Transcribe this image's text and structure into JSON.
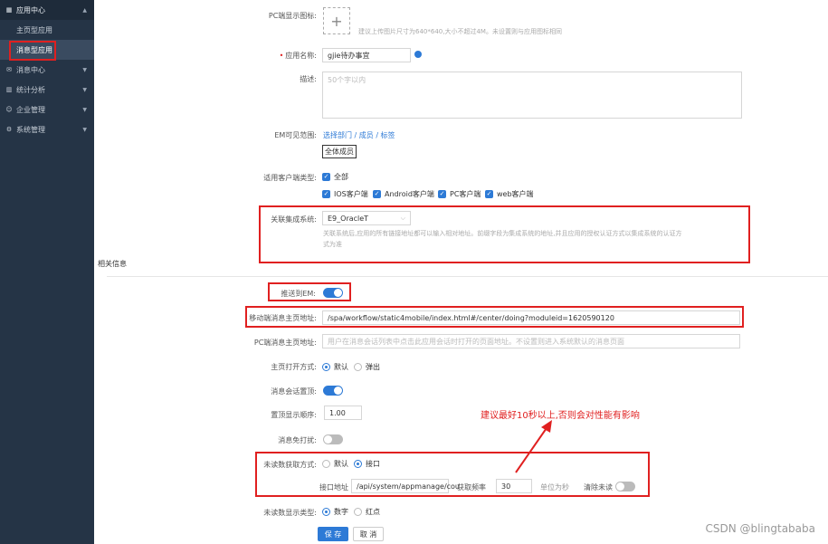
{
  "sidebar": {
    "groups": [
      {
        "label": "应用中心",
        "icon": "grid-icon"
      },
      {
        "label": "消息中心",
        "icon": "mail-icon"
      },
      {
        "label": "统计分析",
        "icon": "chart-icon"
      },
      {
        "label": "企业管理",
        "icon": "user-icon"
      },
      {
        "label": "系统管理",
        "icon": "gear-icon"
      }
    ],
    "sub_items": [
      {
        "label": "主页型应用"
      },
      {
        "label": "消息型应用"
      }
    ]
  },
  "form": {
    "pc_icon": {
      "label": "PC端显示图标:",
      "hint": "建议上传图片尺寸为640*640,大小不超过4M。未设置则与应用图标相同"
    },
    "app_name": {
      "label": "应用名称:",
      "value": "gjie待办事宜"
    },
    "desc": {
      "label": "描述:",
      "placeholder": "50个字以内"
    },
    "em_scope": {
      "label": "EM可见范围:",
      "links": "选择部门 / 成员 / 标签",
      "button": "全体成员"
    },
    "client_types": {
      "label": "适用客户端类型:",
      "all": "全部",
      "options": [
        "IOS客户端",
        "Android客户端",
        "PC客户端",
        "web客户端"
      ]
    },
    "linked_system": {
      "label": "关联集成系统:",
      "value": "E9_OracleT",
      "hint1": "关联系统后,应用的所有链接地址都可以输入相对地址。前缀字段为集成系统的地址,并且应用的授权认证方式以集成系统的认证方",
      "hint2": "式为准"
    },
    "section_title": "相关信息",
    "push_em": {
      "label": "推送到EM:"
    },
    "mobile_home": {
      "label": "移动端消息主页地址:",
      "value": "/spa/workflow/static4mobile/index.html#/center/doing?moduleid=1620590120"
    },
    "pc_home": {
      "label": "PC端消息主页地址:",
      "placeholder": "用户在消息会话列表中点击此应用会话时打开的页面地址。不设置则进入系统默认的消息页面"
    },
    "open_mode": {
      "label": "主页打开方式:",
      "options": [
        "默认",
        "弹出"
      ]
    },
    "session_top": {
      "label": "消息会话置顶:"
    },
    "top_order": {
      "label": "置顶显示顺序:",
      "value": "1.00"
    },
    "no_disturb": {
      "label": "消息免打扰:"
    },
    "unread_fetch": {
      "label": "未读数获取方式:",
      "options": [
        "默认",
        "接口"
      ],
      "api_label": "接口地址",
      "api_value": "/api/system/appmanage/cou",
      "freq_label": "获取频率",
      "freq_value": "30",
      "unit": "单位为秒",
      "clear_label": "清除未读"
    },
    "unread_display": {
      "label": "未读数显示类型:",
      "options": [
        "数字",
        "红点"
      ]
    },
    "save": "保 存",
    "cancel": "取 消"
  },
  "annotation": "建议最好10秒以上,否则会对性能有影响",
  "watermark": "CSDN @blingtababa",
  "colors": {
    "sidebar_bg": "#253446",
    "accent": "#2d7ad6",
    "annotation_red": "#e02020"
  }
}
